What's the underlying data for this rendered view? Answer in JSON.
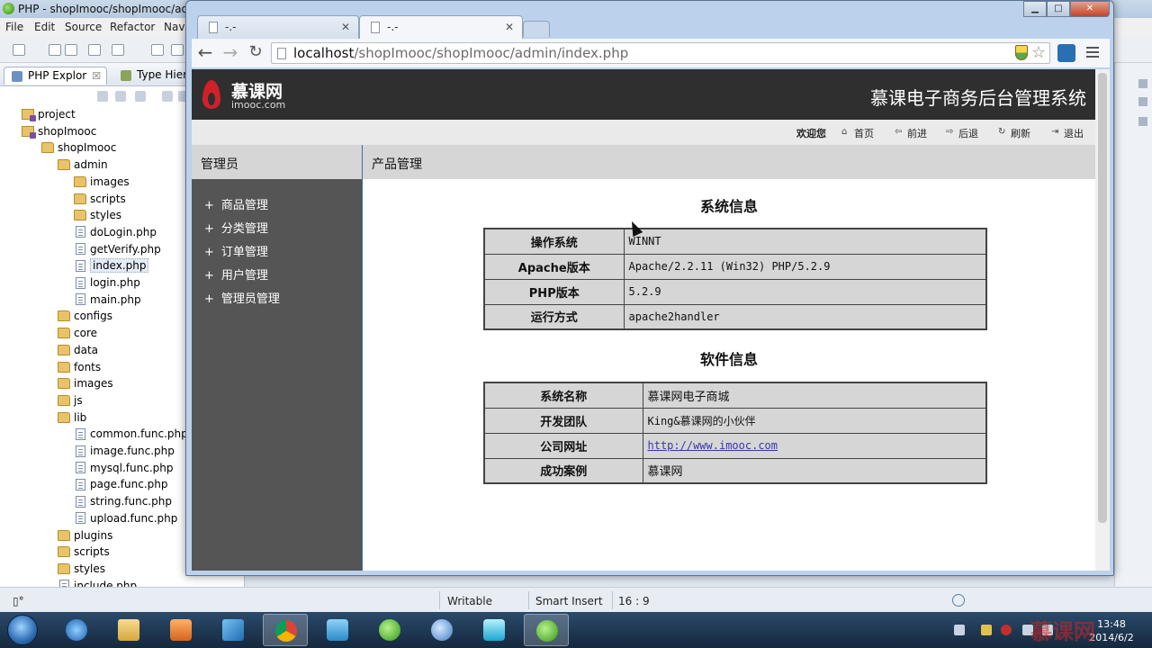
{
  "ide": {
    "title": "PHP - shopImooc/shopImooc/adm",
    "menu": [
      "File",
      "Edit",
      "Source",
      "Refactor",
      "Navi"
    ],
    "pane_tabs": [
      {
        "label": "PHP Explor",
        "close": "☒"
      },
      {
        "label": "Type Hiera"
      }
    ],
    "tree": [
      {
        "label": "project",
        "kind": "project",
        "depth": 0
      },
      {
        "label": "shopImooc",
        "kind": "project",
        "depth": 0
      },
      {
        "label": "shopImooc",
        "kind": "folder",
        "depth": 1
      },
      {
        "label": "admin",
        "kind": "folder",
        "depth": 2
      },
      {
        "label": "images",
        "kind": "folder",
        "depth": 3
      },
      {
        "label": "scripts",
        "kind": "folder",
        "depth": 3
      },
      {
        "label": "styles",
        "kind": "folder",
        "depth": 3
      },
      {
        "label": "doLogin.php",
        "kind": "file",
        "depth": 3
      },
      {
        "label": "getVerify.php",
        "kind": "file",
        "depth": 3
      },
      {
        "label": "index.php",
        "kind": "file",
        "depth": 3,
        "selected": true
      },
      {
        "label": "login.php",
        "kind": "file",
        "depth": 3
      },
      {
        "label": "main.php",
        "kind": "file",
        "depth": 3
      },
      {
        "label": "configs",
        "kind": "folder",
        "depth": 2
      },
      {
        "label": "core",
        "kind": "folder",
        "depth": 2
      },
      {
        "label": "data",
        "kind": "folder",
        "depth": 2
      },
      {
        "label": "fonts",
        "kind": "folder",
        "depth": 2
      },
      {
        "label": "images",
        "kind": "folder",
        "depth": 2
      },
      {
        "label": "js",
        "kind": "folder",
        "depth": 2
      },
      {
        "label": "lib",
        "kind": "folder",
        "depth": 2
      },
      {
        "label": "common.func.php",
        "kind": "file",
        "depth": 3
      },
      {
        "label": "image.func.php",
        "kind": "file",
        "depth": 3
      },
      {
        "label": "mysql.func.php",
        "kind": "file",
        "depth": 3
      },
      {
        "label": "page.func.php",
        "kind": "file",
        "depth": 3
      },
      {
        "label": "string.func.php",
        "kind": "file",
        "depth": 3
      },
      {
        "label": "upload.func.php",
        "kind": "file",
        "depth": 3
      },
      {
        "label": "plugins",
        "kind": "folder",
        "depth": 2
      },
      {
        "label": "scripts",
        "kind": "folder",
        "depth": 2
      },
      {
        "label": "styles",
        "kind": "folder",
        "depth": 2
      },
      {
        "label": "include.php",
        "kind": "file",
        "depth": 2
      }
    ],
    "status": {
      "writable": "Writable",
      "insert_mode": "Smart Insert",
      "position": "16 : 9"
    }
  },
  "browser": {
    "tabs": [
      {
        "title": "-.-"
      },
      {
        "title": "-.-",
        "active": true
      }
    ],
    "url_host": "localhost",
    "url_path": "/shopImooc/shopImooc/admin/index.php",
    "window_buttons": {
      "minimize": "▁",
      "maximize": "□",
      "close": "✕"
    }
  },
  "site": {
    "logo_name": "慕课网",
    "logo_domain": "imooc.com",
    "system_title": "慕课电子商务后台管理系统",
    "welcome": "欢迎您",
    "nav": [
      {
        "label": "首页",
        "icon": "home-icon",
        "glyph": "⌂"
      },
      {
        "label": "前进",
        "icon": "forward-icon",
        "glyph": "⇦"
      },
      {
        "label": "后退",
        "icon": "back-icon",
        "glyph": "⇨"
      },
      {
        "label": "刷新",
        "icon": "refresh-icon",
        "glyph": "↻"
      },
      {
        "label": "退出",
        "icon": "logout-icon",
        "glyph": "⇥"
      }
    ],
    "sidebar_title": "管理员",
    "sidebar_items": [
      "商品管理",
      "分类管理",
      "订单管理",
      "用户管理",
      "管理员管理"
    ],
    "main_title": "产品管理",
    "system_info": {
      "title": "系统信息",
      "rows": [
        {
          "key": "操作系统",
          "value": "WINNT"
        },
        {
          "key": "Apache版本",
          "value": "Apache/2.2.11 (Win32) PHP/5.2.9"
        },
        {
          "key": "PHP版本",
          "value": "5.2.9"
        },
        {
          "key": "运行方式",
          "value": "apache2handler"
        }
      ]
    },
    "software_info": {
      "title": "软件信息",
      "rows": [
        {
          "key": "系统名称",
          "value": "慕课网电子商城"
        },
        {
          "key": "开发团队",
          "value": "King&慕课网的小伙伴"
        },
        {
          "key": "公司网址",
          "value": "http://www.imooc.com",
          "link": true
        },
        {
          "key": "成功案例",
          "value": "慕课网"
        }
      ]
    }
  },
  "taskbar": {
    "time": "13:48",
    "date": "2014/6/2"
  },
  "watermark": "慕课网"
}
